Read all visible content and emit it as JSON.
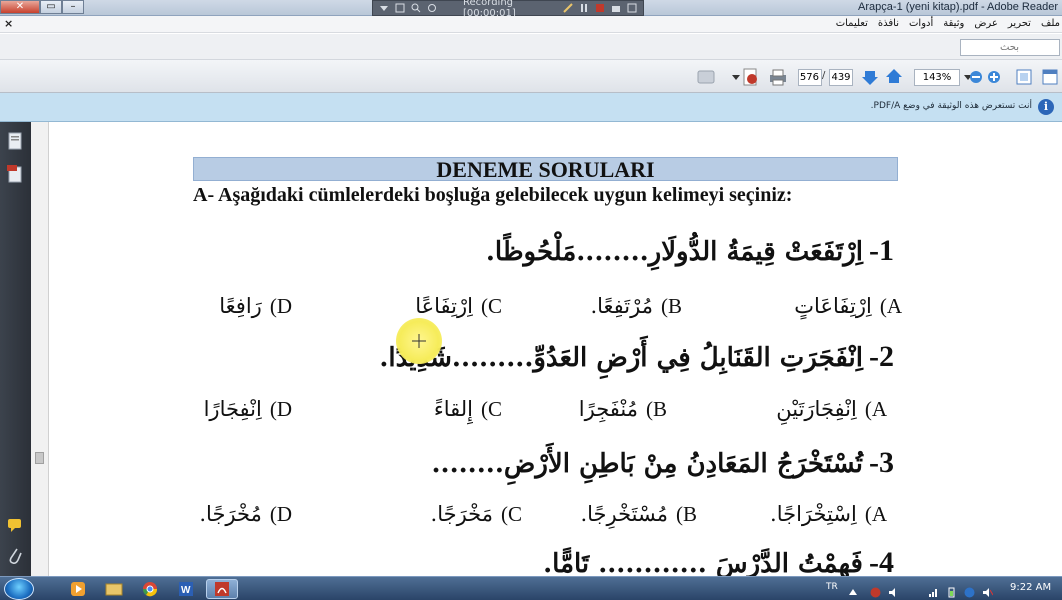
{
  "window": {
    "title": "Arapça-1 (yeni kitap).pdf - Adobe Reader",
    "close_symbol": "✕",
    "recording_label": "Recording [00:00:01]"
  },
  "menu": {
    "close_symbol": "×",
    "items": [
      "ملف",
      "تحرير",
      "عرض",
      "وثيقة",
      "أدوات",
      "نافذة",
      "تعليمات"
    ]
  },
  "search": {
    "placeholder": "بحث"
  },
  "toolbar": {
    "page_current": "576",
    "page_separator": "/",
    "page_total": "439",
    "zoom": "143%"
  },
  "infobar": {
    "text": "أنت تستعرض هذه الوثيقة في وضع PDF/A.",
    "icon_glyph": "i"
  },
  "document": {
    "title": "DENEME SORULARI",
    "instruction": "A- Aşağıdaki cümlelerdeki boşluğa gelebilecek uygun kelimeyi seçiniz:",
    "questions": [
      {
        "number": "1-",
        "text": "اِرْتَفَعَتْ قِيمَةُ الدُّولَارِ........مَلْحُوظًا.",
        "options": [
          {
            "letter": "A)",
            "text": "اِرْتِفَاعَاتٍ"
          },
          {
            "letter": "B)",
            "text": "مُرْتَفِعًا."
          },
          {
            "letter": "C)",
            "text": "اِرْتِفَاعًا"
          },
          {
            "letter": "D)",
            "text": "رَافِعًا"
          }
        ]
      },
      {
        "number": "2-",
        "text": "اِنْفَجَرَتِ القَنَابِلُ فِي أَرْضِ العَدُوِّ.........شَدِيدًا.",
        "options": [
          {
            "letter": "A)",
            "text": "اِنْفِجَارَتَيْنِ"
          },
          {
            "letter": "B)",
            "text": "مُنْفَجِرًا"
          },
          {
            "letter": "C)",
            "text": "إِلقاءً"
          },
          {
            "letter": "D)",
            "text": "اِنْفِجَارًا"
          }
        ]
      },
      {
        "number": "3-",
        "text": "تُسْتَخْرَجُ المَعَادِنُ مِنْ بَاطِنِ الأَرْضِ........",
        "options": [
          {
            "letter": "A)",
            "text": "اِسْتِخْرَاجًا."
          },
          {
            "letter": "B)",
            "text": "مُسْتَخْرِجًا."
          },
          {
            "letter": "C)",
            "text": "مَخْرَجًا."
          },
          {
            "letter": "D)",
            "text": "مُخْرَجًا."
          }
        ]
      },
      {
        "number": "4-",
        "text": "فَهِمْتُ الدَّرْسَ ............ تَامًّا."
      }
    ]
  },
  "taskbar": {
    "language": "TR",
    "clock": "9:22 AM"
  }
}
